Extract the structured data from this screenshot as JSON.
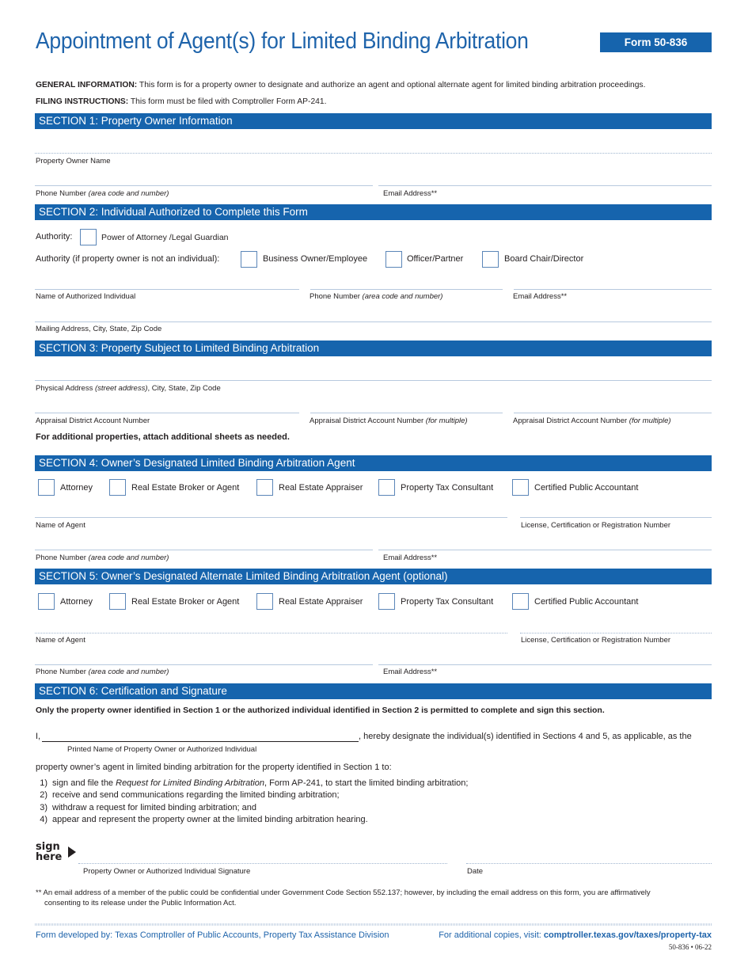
{
  "header": {
    "title": "Appointment of Agent(s) for Limited Binding Arbitration",
    "form_number": "Form 50-836"
  },
  "intro": {
    "general_label": "GENERAL INFORMATION:",
    "general_text": " This form is for a property owner to designate and authorize an agent and optional alternate agent for limited binding arbitration proceedings.",
    "filing_label": "FILING INSTRUCTIONS:",
    "filing_text": " This form must be filed with Comptroller Form AP-241."
  },
  "section1": {
    "title": "SECTION 1: Property Owner Information",
    "owner_name_label": "Property Owner Name",
    "phone_label": "Phone Number",
    "phone_hint": "(area code and number)",
    "email_label": "Email Address**",
    "owner_name_value": "",
    "phone_value": "",
    "email_value": ""
  },
  "section2": {
    "title": "SECTION 2: Individual Authorized to Complete this Form",
    "authority_label": "Authority:",
    "authority_option": "Power of Attorney /Legal Guardian",
    "authority_nonindividual_label": "Authority (if property owner is not an individual):",
    "nonindividual_options": [
      "Business Owner/Employee",
      "Officer/Partner",
      "Board Chair/Director"
    ],
    "name_label": "Name of Authorized Individual",
    "phone_label": "Phone Number",
    "phone_hint": "(area code and number)",
    "email_label": "Email Address**",
    "mailing_label": "Mailing Address, City, State, Zip Code"
  },
  "section3": {
    "title": "SECTION 3: Property Subject to Limited Binding Arbitration",
    "physical_label": "Physical Address",
    "physical_hint": "(street address)",
    "physical_suffix": ", City, State, Zip Code",
    "account_label": "Appraisal District Account Number",
    "account_multi_label": "Appraisal District Account Number",
    "account_multi_hint": "(for multiple)",
    "note": "For additional properties, attach additional sheets as needed."
  },
  "section4": {
    "title": "SECTION 4: Owner’s Designated Limited Binding Arbitration Agent",
    "options": [
      "Attorney",
      "Real Estate Broker or Agent",
      "Real Estate Appraiser",
      "Property Tax Consultant",
      "Certified Public Accountant"
    ],
    "name_label": "Name of Agent",
    "license_label": "License, Certification or Registration Number",
    "phone_label": "Phone Number",
    "phone_hint": "(area code and number)",
    "email_label": "Email Address**"
  },
  "section5": {
    "title": "SECTION 5: Owner’s Designated Alternate Limited Binding Arbitration Agent (optional)",
    "options": [
      "Attorney",
      "Real Estate Broker or Agent",
      "Real Estate Appraiser",
      "Property Tax Consultant",
      "Certified Public Accountant"
    ],
    "name_label": "Name of Agent",
    "license_label": "License, Certification or Registration Number",
    "phone_label": "Phone Number",
    "phone_hint": "(area code and number)",
    "email_label": "Email Address**"
  },
  "section6": {
    "title": "SECTION 6: Certification and Signature",
    "notice": "Only the property owner identified in Section 1 or the authorized individual identified in Section 2 is permitted to complete and sign this section.",
    "i_prefix": "I,",
    "designate_text": ", hereby designate the individual(s) identified in Sections 4 and 5, as applicable, as the",
    "printed_name_label": "Printed Name of Property Owner or Authorized Individual",
    "agent_text": "property owner’s agent in limited binding arbitration for the property identified in Section 1 to:",
    "items": [
      {
        "n": "1)",
        "pre": "sign and file the ",
        "em": "Request for Limited Binding Arbitration",
        "post": ", Form AP-241, to start the limited binding arbitration;"
      },
      {
        "n": "2)",
        "pre": "receive and send communications regarding the limited binding arbitration;",
        "em": "",
        "post": ""
      },
      {
        "n": "3)",
        "pre": "withdraw a request for limited binding arbitration; and",
        "em": "",
        "post": ""
      },
      {
        "n": "4)",
        "pre": "appear and represent the property owner at the limited binding arbitration hearing.",
        "em": "",
        "post": ""
      }
    ],
    "sign_word1": "sign",
    "sign_word2": "here",
    "signature_label": "Property Owner or Authorized Individual Signature",
    "date_label": "Date"
  },
  "footnote": {
    "line1": "** An email address of a member of the public could be confidential under Government Code Section 552.137; however, by including the email address on this form, you are affirmatively",
    "line2": "consenting to its release under the Public Information Act."
  },
  "footer": {
    "developed_by": "Form developed by: Texas Comptroller of Public Accounts, Property Tax Assistance Division",
    "copies_prefix": "For additional copies, visit: ",
    "copies_link": "comptroller.texas.gov/taxes/property-tax",
    "version": "50-836 • 06-22"
  },
  "colors": {
    "brand_blue": "#1664ad",
    "title_blue": "#1f64ab",
    "rule": "#b7c9de"
  }
}
